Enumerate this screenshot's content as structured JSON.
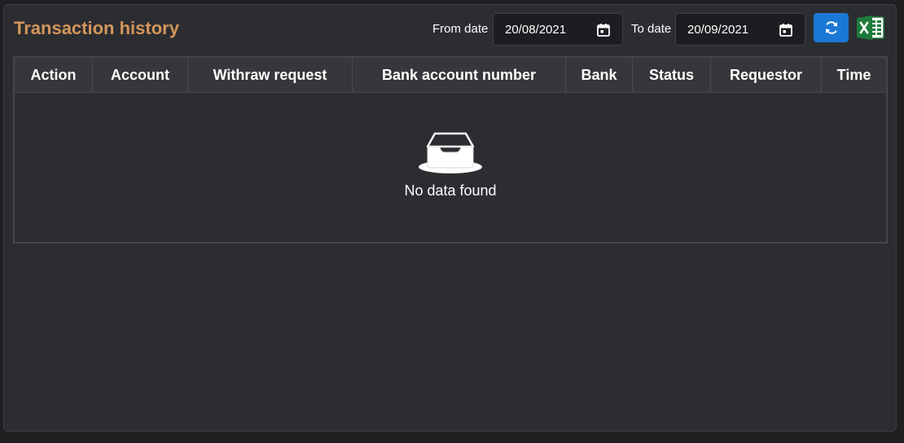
{
  "header": {
    "title": "Transaction history",
    "from_label": "From date",
    "from_value": "20/08/2021",
    "to_label": "To date",
    "to_value": "20/09/2021"
  },
  "table": {
    "columns": [
      "Action",
      "Account",
      "Withraw request",
      "Bank account number",
      "Bank",
      "Status",
      "Requestor",
      "Time"
    ],
    "empty_text": "No data found"
  },
  "colors": {
    "title": "#d4965a",
    "refresh_button": "#1a78d4",
    "excel_green": "#1e7b3c"
  },
  "icons": [
    "calendar-icon",
    "refresh-icon",
    "excel-icon",
    "empty-inbox-icon"
  ]
}
